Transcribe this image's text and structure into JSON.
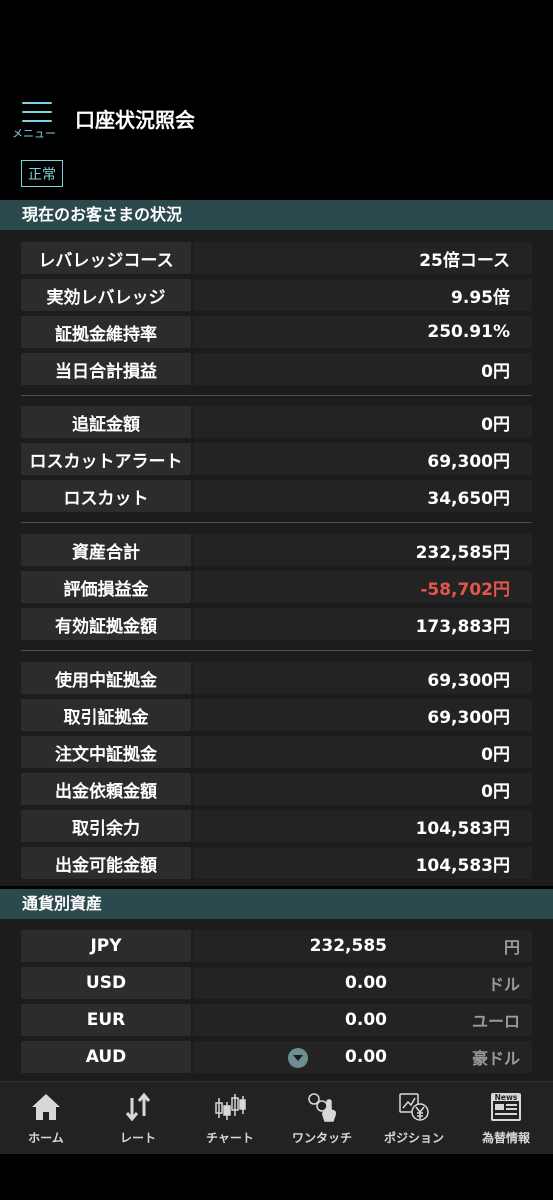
{
  "header": {
    "menu_label": "メニュー",
    "title": "口座状況照会",
    "status": "正常"
  },
  "section1": {
    "title": "現在のお客さまの状況",
    "rows": [
      {
        "label": "レバレッジコース",
        "value": "25倍コース"
      },
      {
        "label": "実効レバレッジ",
        "value": "9.95倍"
      },
      {
        "label": "証拠金維持率",
        "value": "250.91%"
      },
      {
        "label": "当日合計損益",
        "value": "0円"
      },
      {
        "label": "追証金額",
        "value": "0円"
      },
      {
        "label": "ロスカットアラート",
        "value": "69,300円"
      },
      {
        "label": "ロスカット",
        "value": "34,650円"
      },
      {
        "label": "資産合計",
        "value": "232,585円"
      },
      {
        "label": "評価損益金",
        "value": "-58,702円"
      },
      {
        "label": "有効証拠金額",
        "value": "173,883円"
      },
      {
        "label": "使用中証拠金",
        "value": "69,300円"
      },
      {
        "label": "取引証拠金",
        "value": "69,300円"
      },
      {
        "label": "注文中証拠金",
        "value": "0円"
      },
      {
        "label": "出金依頼金額",
        "value": "0円"
      },
      {
        "label": "取引余力",
        "value": "104,583円"
      },
      {
        "label": "出金可能金額",
        "value": "104,583円"
      }
    ]
  },
  "section2": {
    "title": "通貨別資産",
    "rows": [
      {
        "label": "JPY",
        "amount": "232,585",
        "unit": "円"
      },
      {
        "label": "USD",
        "amount": "0.00",
        "unit": "ドル"
      },
      {
        "label": "EUR",
        "amount": "0.00",
        "unit": "ユーロ"
      },
      {
        "label": "AUD",
        "amount": "0.00",
        "unit": "豪ドル"
      }
    ]
  },
  "tabs": [
    {
      "label": "ホーム",
      "icon": "home-icon"
    },
    {
      "label": "レート",
      "icon": "rate-arrows-icon"
    },
    {
      "label": "チャート",
      "icon": "candlestick-chart-icon"
    },
    {
      "label": "ワンタッチ",
      "icon": "one-touch-icon"
    },
    {
      "label": "ポジション",
      "icon": "position-icon"
    },
    {
      "label": "為替情報",
      "icon": "news-icon"
    }
  ],
  "icons": {
    "news_text": "News"
  },
  "colors": {
    "accent": "#7fd3de",
    "section_bg": "#2c4a4d",
    "negative": "#e4564d"
  }
}
